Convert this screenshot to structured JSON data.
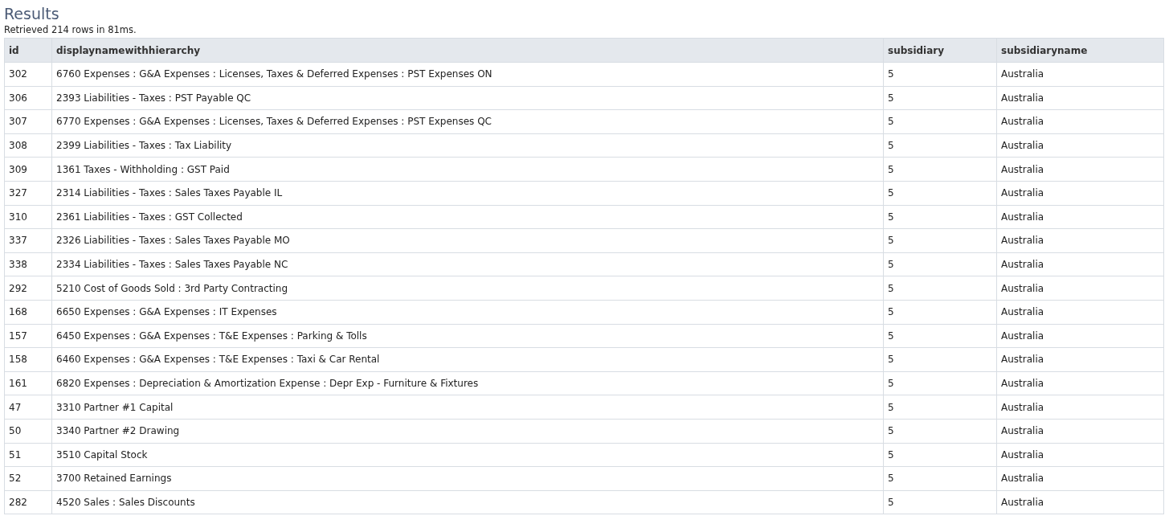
{
  "title": "Results",
  "summary": "Retrieved 214 rows in 81ms.",
  "table": {
    "columns": [
      "id",
      "displaynamewithhierarchy",
      "subsidiary",
      "subsidiaryname"
    ],
    "rows": [
      [
        "302",
        "6760 Expenses : G&A Expenses : Licenses, Taxes & Deferred Expenses : PST Expenses ON",
        "5",
        "Australia"
      ],
      [
        "306",
        "2393 Liabilities - Taxes : PST Payable QC",
        "5",
        "Australia"
      ],
      [
        "307",
        "6770 Expenses : G&A Expenses : Licenses, Taxes & Deferred Expenses : PST Expenses QC",
        "5",
        "Australia"
      ],
      [
        "308",
        "2399 Liabilities - Taxes : Tax Liability",
        "5",
        "Australia"
      ],
      [
        "309",
        "1361 Taxes - Withholding : GST Paid",
        "5",
        "Australia"
      ],
      [
        "327",
        "2314 Liabilities - Taxes : Sales Taxes Payable IL",
        "5",
        "Australia"
      ],
      [
        "310",
        "2361 Liabilities - Taxes : GST Collected",
        "5",
        "Australia"
      ],
      [
        "337",
        "2326 Liabilities - Taxes : Sales Taxes Payable MO",
        "5",
        "Australia"
      ],
      [
        "338",
        "2334 Liabilities - Taxes : Sales Taxes Payable NC",
        "5",
        "Australia"
      ],
      [
        "292",
        "5210 Cost of Goods Sold : 3rd Party Contracting",
        "5",
        "Australia"
      ],
      [
        "168",
        "6650 Expenses : G&A Expenses : IT Expenses",
        "5",
        "Australia"
      ],
      [
        "157",
        "6450 Expenses : G&A Expenses : T&E Expenses : Parking & Tolls",
        "5",
        "Australia"
      ],
      [
        "158",
        "6460 Expenses : G&A Expenses : T&E Expenses : Taxi & Car Rental",
        "5",
        "Australia"
      ],
      [
        "161",
        "6820 Expenses : Depreciation & Amortization Expense : Depr Exp - Furniture & Fixtures",
        "5",
        "Australia"
      ],
      [
        "47",
        "3310 Partner #1 Capital",
        "5",
        "Australia"
      ],
      [
        "50",
        "3340 Partner #2 Drawing",
        "5",
        "Australia"
      ],
      [
        "51",
        "3510 Capital Stock",
        "5",
        "Australia"
      ],
      [
        "52",
        "3700 Retained Earnings",
        "5",
        "Australia"
      ],
      [
        "282",
        "4520 Sales : Sales Discounts",
        "5",
        "Australia"
      ]
    ]
  }
}
